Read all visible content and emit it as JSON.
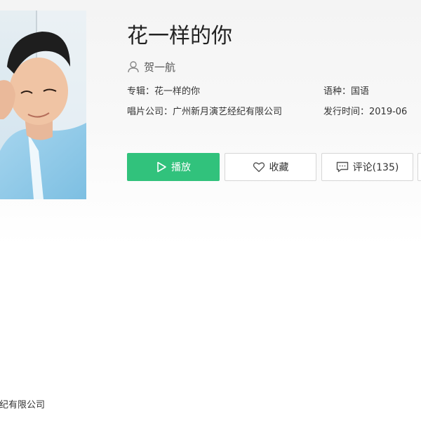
{
  "song": {
    "title": "花一样的你",
    "artist": "贺一航"
  },
  "meta": {
    "album_label": "专辑：",
    "album_value": "花一样的你",
    "language_label": "语种：",
    "language_value": "国语",
    "company_label": "唱片公司：",
    "company_value": "广州新月演艺经纪有限公司",
    "release_label": "发行时间：",
    "release_value": "2019-06"
  },
  "actions": {
    "play_label": "播放",
    "favorite_label": "收藏",
    "comment_label": "评论(135)"
  },
  "footer": {
    "company_fragment": "演艺经纪有限公司"
  },
  "colors": {
    "accent": "#31c27c",
    "border": "#d6d6d6"
  },
  "icons": {
    "user": "user-icon",
    "play": "play-icon",
    "heart": "heart-icon",
    "comment": "comment-icon"
  }
}
